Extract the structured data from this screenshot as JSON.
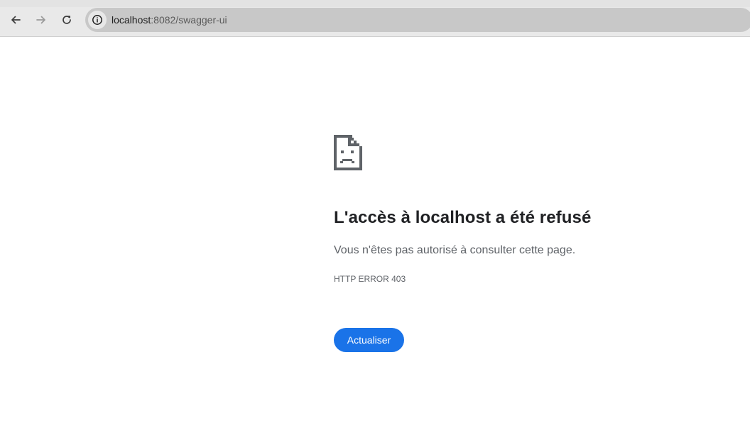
{
  "browser": {
    "url_host": "localhost",
    "url_rest": ":8082/swagger-ui",
    "icons": {
      "back": "arrow-left-icon",
      "forward": "arrow-right-icon",
      "reload": "reload-icon",
      "site_info": "info-icon"
    }
  },
  "error_page": {
    "icon": "sad-page-icon",
    "title": "L'accès à localhost a été refusé",
    "message": "Vous n'êtes pas autorisé à consulter cette page.",
    "code": "HTTP ERROR 403",
    "reload_label": "Actualiser"
  },
  "colors": {
    "button_bg": "#1a73e8",
    "title_text": "#202124",
    "secondary_text": "#5f6368"
  }
}
